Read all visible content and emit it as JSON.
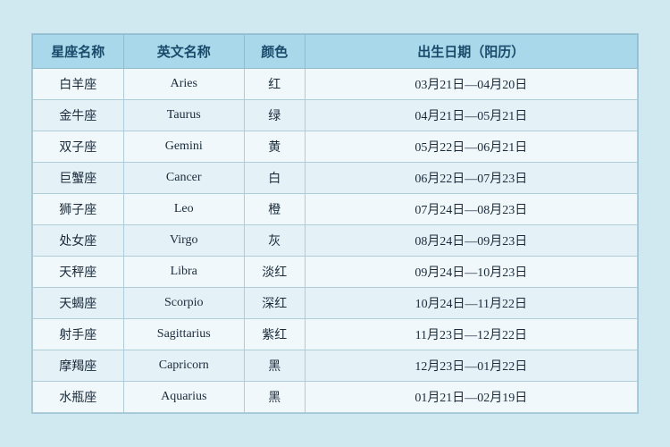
{
  "table": {
    "headers": {
      "cn_name": "星座名称",
      "en_name": "英文名称",
      "color": "颜色",
      "date": "出生日期（阳历）"
    },
    "rows": [
      {
        "cn": "白羊座",
        "en": "Aries",
        "color": "红",
        "date": "03月21日—04月20日"
      },
      {
        "cn": "金牛座",
        "en": "Taurus",
        "color": "绿",
        "date": "04月21日—05月21日"
      },
      {
        "cn": "双子座",
        "en": "Gemini",
        "color": "黄",
        "date": "05月22日—06月21日"
      },
      {
        "cn": "巨蟹座",
        "en": "Cancer",
        "color": "白",
        "date": "06月22日—07月23日"
      },
      {
        "cn": "狮子座",
        "en": "Leo",
        "color": "橙",
        "date": "07月24日—08月23日"
      },
      {
        "cn": "处女座",
        "en": "Virgo",
        "color": "灰",
        "date": "08月24日—09月23日"
      },
      {
        "cn": "天秤座",
        "en": "Libra",
        "color": "淡红",
        "date": "09月24日—10月23日"
      },
      {
        "cn": "天蝎座",
        "en": "Scorpio",
        "color": "深红",
        "date": "10月24日—11月22日"
      },
      {
        "cn": "射手座",
        "en": "Sagittarius",
        "color": "紫红",
        "date": "11月23日—12月22日"
      },
      {
        "cn": "摩羯座",
        "en": "Capricorn",
        "color": "黑",
        "date": "12月23日—01月22日"
      },
      {
        "cn": "水瓶座",
        "en": "Aquarius",
        "color": "黑",
        "date": "01月21日—02月19日"
      }
    ]
  }
}
